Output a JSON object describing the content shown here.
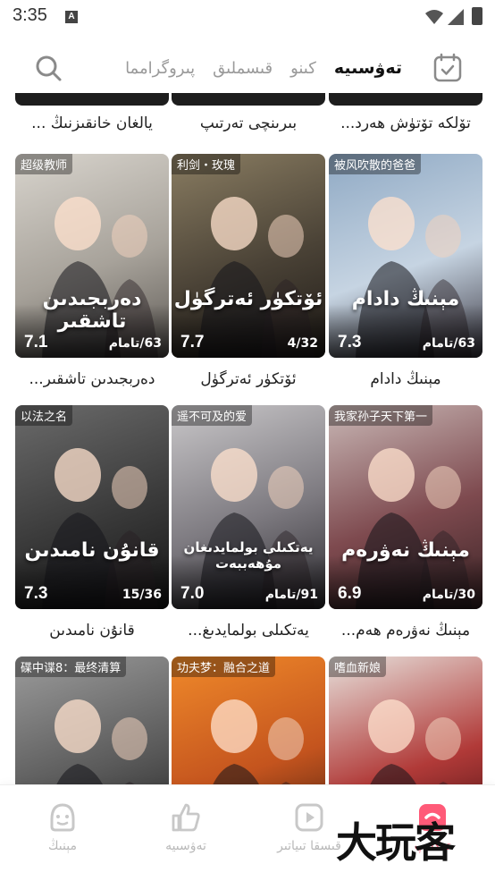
{
  "status_bar": {
    "time": "3:35",
    "notification": "A"
  },
  "top_nav": {
    "tabs": [
      {
        "label": "تەۋسىيە",
        "active": true
      },
      {
        "label": "كىنو",
        "active": false
      },
      {
        "label": "قىسملىق",
        "active": false
      },
      {
        "label": "پىروگرامما",
        "active": false
      }
    ],
    "search_icon": "search-icon",
    "calendar_icon": "calendar-check-icon"
  },
  "top_row_titles": [
    "تۆلكە تۆتۈش ھەرد...",
    "بىرىنچى تەرتىپ",
    "يالغان خانقىزنىڭ ..."
  ],
  "dramas": [
    {
      "tag": "被风吹散的爸爸",
      "rating": "7.3",
      "episodes": "63/تامام",
      "title": "مېنىڭ دادام",
      "overlay": "مېنىڭ دادام",
      "colors": [
        "#8fa9c4",
        "#c6d4e2",
        "#3d3a44"
      ]
    },
    {
      "tag": "利剑・玫瑰",
      "rating": "7.7",
      "episodes": "4/32",
      "title": "ئۆتكۈر ئەترگۈل",
      "overlay": "ئۆتكۈر ئەترگۈل",
      "colors": [
        "#8a7d62",
        "#4a4236",
        "#1f1b17"
      ]
    },
    {
      "tag": "超级教师",
      "rating": "7.1",
      "episodes": "63/تامام",
      "title": "دەربجىدىن تاشقىر...",
      "overlay": "دەربجىدىن تاشقىر",
      "colors": [
        "#d8d4cd",
        "#a7a29a",
        "#5e5a55"
      ]
    },
    {
      "tag": "我家孙子天下第一",
      "rating": "6.9",
      "episodes": "30/تامام",
      "title": "مېنىڭ نەۋرەم ھەم...",
      "overlay": "مېنىڭ نەۋرەم",
      "colors": [
        "#c9b8b6",
        "#7e4a4f",
        "#3b2426"
      ]
    },
    {
      "tag": "遥不可及的爱",
      "rating": "7.0",
      "episodes": "91/تامام",
      "title": "يەتكىلى بولمايدىغ...",
      "overlay": "يەتكىلى بولمايدىغان مۇھەببەت",
      "colors": [
        "#c9c7c9",
        "#7d7a80",
        "#2e2c31"
      ]
    },
    {
      "tag": "以法之名",
      "rating": "7.3",
      "episodes": "15/36",
      "title": "قانۇن نامىدىن",
      "overlay": "قانۇن نامىدىن",
      "colors": [
        "#6b6b6b",
        "#3a3a3a",
        "#151515"
      ]
    },
    {
      "tag": "嗜血新娘",
      "rating": "",
      "episodes": "",
      "title": "",
      "overlay": "",
      "colors": [
        "#e7e1dc",
        "#b13a38",
        "#3a0d10"
      ]
    },
    {
      "tag": "功夫梦：融合之道",
      "rating": "",
      "episodes": "",
      "title": "",
      "overlay": "",
      "colors": [
        "#f08a2a",
        "#c4541e",
        "#3b1a10"
      ]
    },
    {
      "tag": "碟中谍8：最终清算",
      "rating": "",
      "episodes": "",
      "title": "",
      "overlay": "",
      "colors": [
        "#9c9c9c",
        "#5a5a5a",
        "#1d1d1d"
      ]
    }
  ],
  "bottom_nav": [
    {
      "label": "مېنىڭ",
      "icon": "face-smile-icon",
      "active": false
    },
    {
      "label": "تەۋسىيە",
      "icon": "thumbs-up-icon",
      "active": false
    },
    {
      "label": "قىسقا تىياتىر",
      "icon": "play-square-icon",
      "active": false
    },
    {
      "label": "تەكلىپ",
      "icon": "home-icon",
      "active": true
    }
  ],
  "watermark": "大玩客",
  "accent_color": "#ff5a78"
}
